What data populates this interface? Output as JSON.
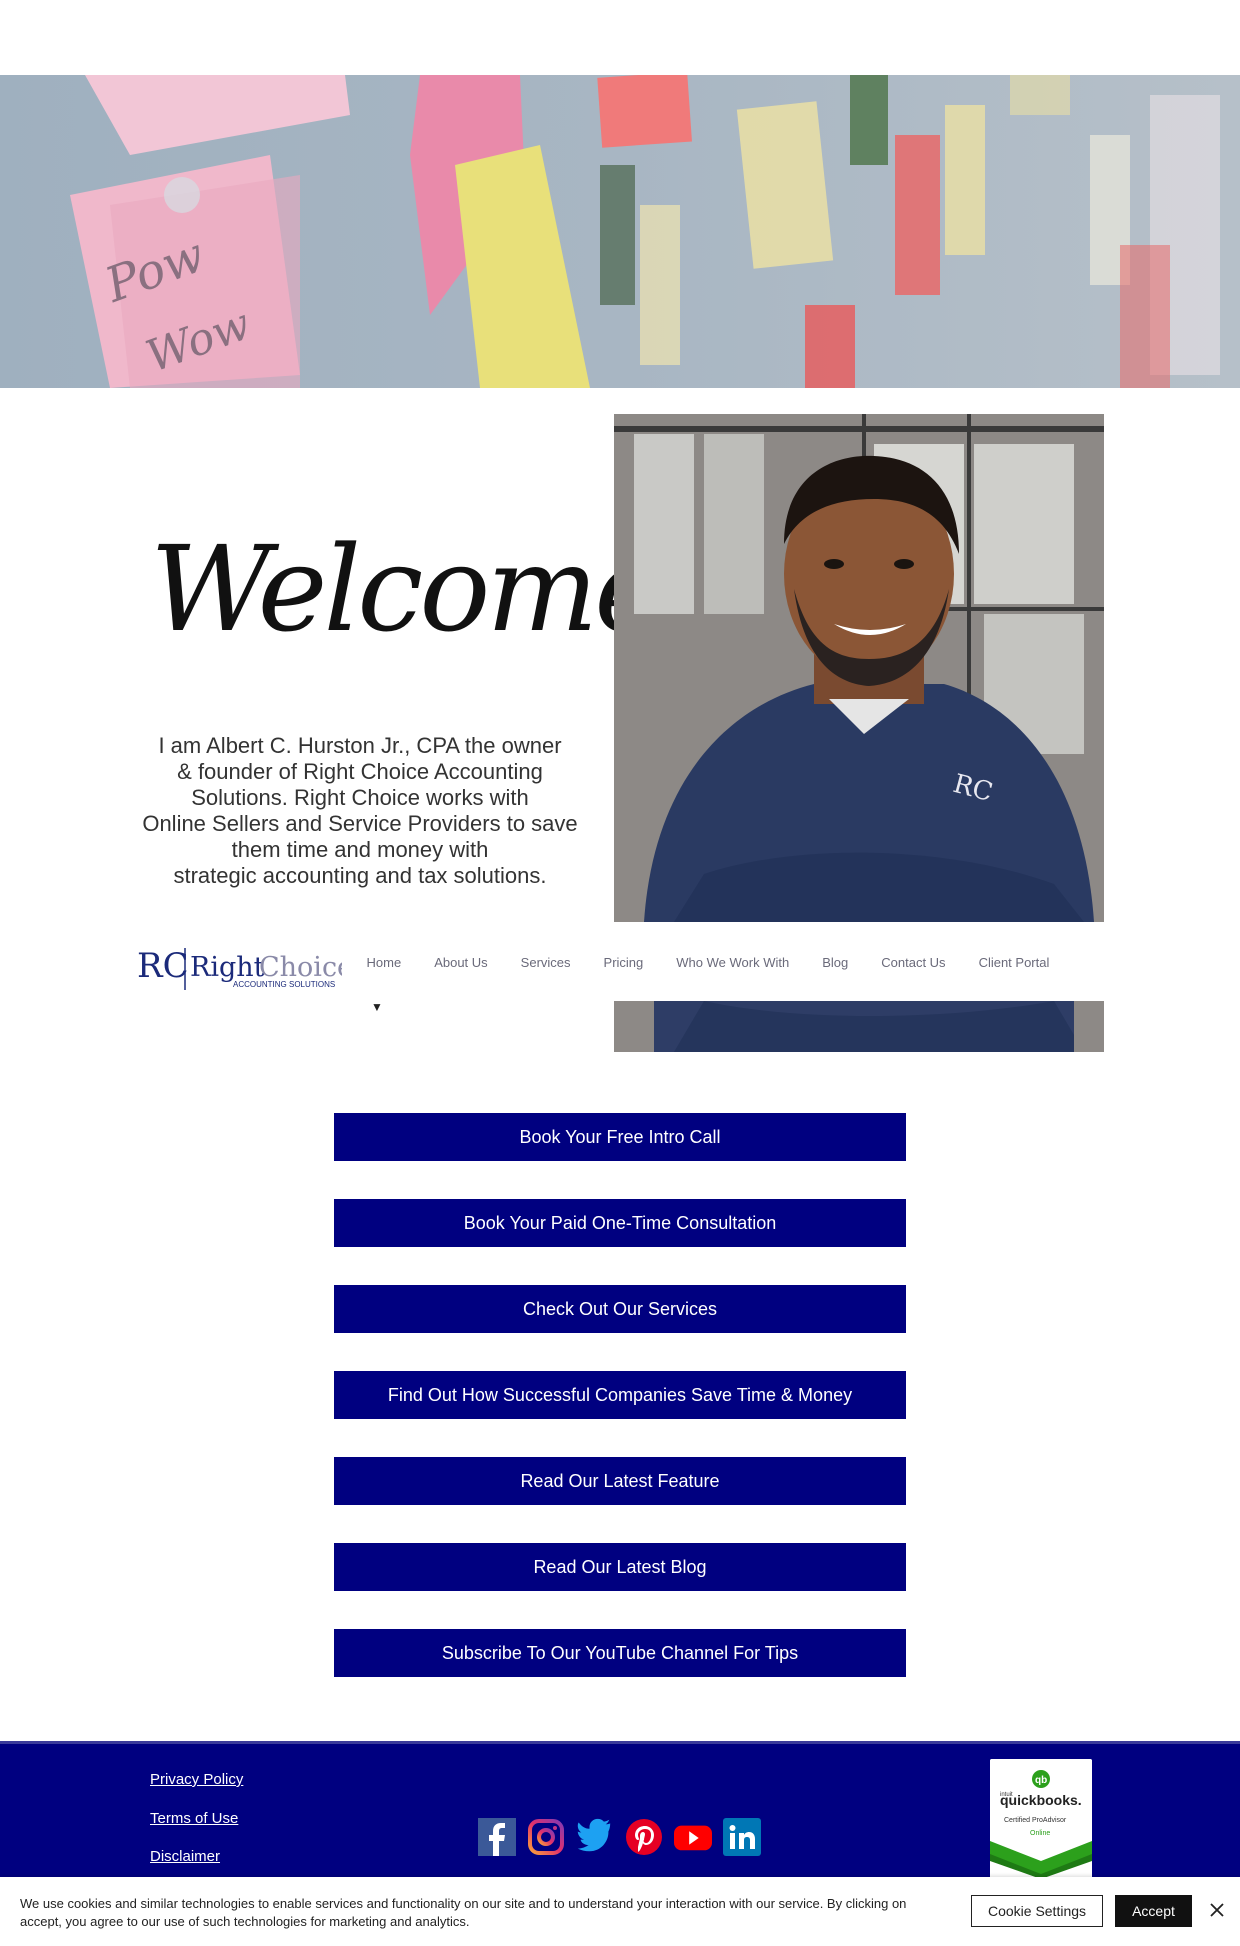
{
  "hero": {
    "note_text_1": "Pow",
    "note_text_2": "Wow"
  },
  "welcome": {
    "title": "Welcome!",
    "intro_lines": [
      "I am Albert C. Hurston Jr., CPA the owner",
      "& founder of Right Choice Accounting",
      "Solutions. Right Choice works with",
      "Online Sellers and Service Providers to save",
      "them time and money with",
      "strategic accounting and tax solutions."
    ]
  },
  "logo": {
    "mark": "RC",
    "name_right": "Right",
    "name_choice": "Choice",
    "tagline": "ACCOUNTING SOLUTIONS"
  },
  "nav": {
    "items": [
      "Home",
      "About Us",
      "Services",
      "Pricing",
      "Who We Work With",
      "Blog",
      "Contact Us",
      "Client Portal"
    ],
    "dropdown_arrow": "▼"
  },
  "buttons": [
    "Book Your Free Intro Call",
    "Book Your Paid One-Time Consultation",
    "Check Out Our Services",
    "Find Out How Successful Companies Save Time & Money",
    "Read Our Latest Feature",
    "Read Our Latest Blog",
    "Subscribe To Our YouTube Channel For Tips"
  ],
  "footer": {
    "links": [
      "Privacy Policy",
      "Terms of Use",
      "Disclaimer"
    ],
    "social_icons": [
      "facebook-icon",
      "instagram-icon",
      "twitter-icon",
      "pinterest-icon",
      "youtube-icon",
      "linkedin-icon"
    ],
    "badge": {
      "intuit": "intuit",
      "brand": "quickbooks.",
      "line1": "Certified ProAdvisor",
      "line2": "Online"
    }
  },
  "cookie": {
    "text": "We use cookies and similar technologies to enable services and functionality on our site and to understand your interaction with our service. By clicking on accept, you agree to our use of such technologies for marketing and analytics.",
    "settings_label": "Cookie Settings",
    "accept_label": "Accept"
  },
  "colors": {
    "primary_navy": "#000080",
    "footer_bg": "#000080"
  }
}
